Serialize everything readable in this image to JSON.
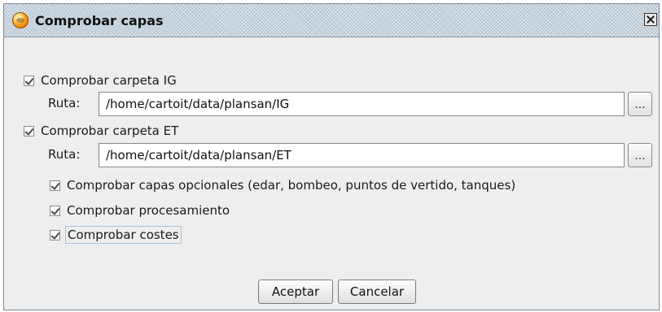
{
  "window": {
    "title": "Comprobar capas",
    "app_icon": "gvsig-app-icon",
    "close_icon": "close-icon"
  },
  "ig": {
    "check_label": "Comprobar carpeta IG",
    "checked": true,
    "ruta_label": "Ruta:",
    "path": "/home/cartoit/data/plansan/IG",
    "browse_label": "..."
  },
  "et": {
    "check_label": "Comprobar carpeta ET",
    "checked": true,
    "ruta_label": "Ruta:",
    "path": "/home/cartoit/data/plansan/ET",
    "browse_label": "..."
  },
  "options": [
    {
      "label": "Comprobar capas opcionales (edar, bombeo, puntos de vertido, tanques)",
      "checked": true
    },
    {
      "label": "Comprobar procesamiento",
      "checked": true
    },
    {
      "label": "Comprobar costes",
      "checked": true
    }
  ],
  "buttons": {
    "accept": "Aceptar",
    "cancel": "Cancelar"
  }
}
